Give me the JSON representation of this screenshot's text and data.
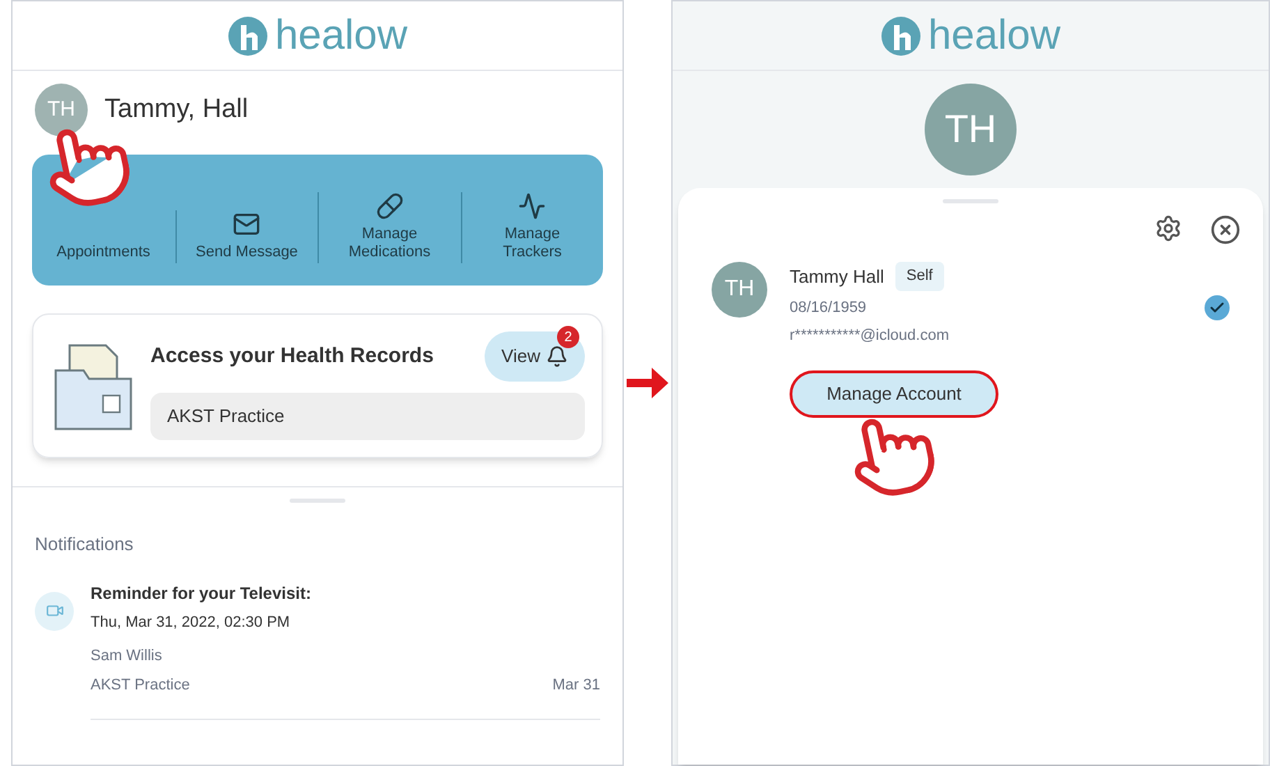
{
  "home_screen": {
    "logo": "healow",
    "user": {
      "initials": "TH",
      "name": "Tammy, Hall"
    },
    "quick_actions": [
      {
        "label": "Appointments",
        "kind": "hidden"
      },
      {
        "label": "Send Message",
        "kind": "message"
      },
      {
        "label": "Manage Medications",
        "kind": "pills"
      },
      {
        "label": "Manage Trackers",
        "kind": "pulse"
      }
    ],
    "health_records": {
      "title": "Access your Health Records",
      "view_button": "View",
      "badge": "2",
      "practice": "AKST Practice"
    },
    "notifications": {
      "title": "Notifications",
      "items": [
        {
          "title": "Reminder for your Televisit:",
          "datetime": "Thu, Mar 31, 2022, 02:30 PM",
          "provider": "Sam Willis",
          "practice": "AKST Practice",
          "date": "Mar 31"
        }
      ]
    }
  },
  "account_screen": {
    "logo": "healow",
    "avatar_initials": "TH",
    "accounts": [
      {
        "initials": "TH",
        "name": "Tammy Hall",
        "tag": "Self",
        "dob": "08/16/1959",
        "email": "r***********@icloud.com",
        "selected": true
      }
    ],
    "manage_button": "Manage Account"
  }
}
